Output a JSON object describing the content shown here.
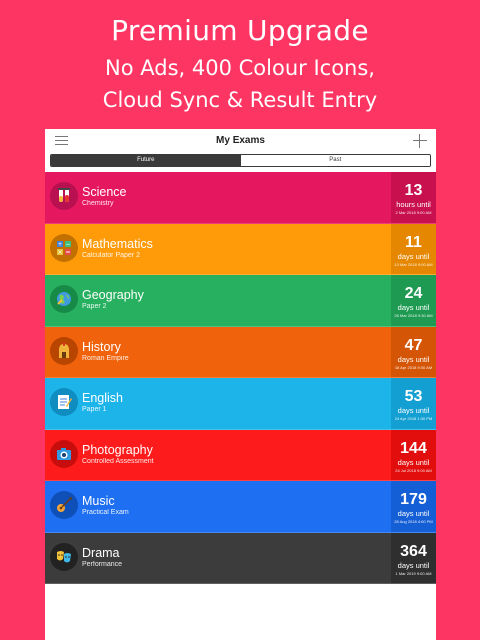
{
  "promo": {
    "title": "Premium Upgrade",
    "line1": "No Ads, 400 Colour Icons,",
    "line2": "Cloud Sync & Result Entry"
  },
  "navbar": {
    "title": "My Exams",
    "menu_icon": "hamburger-menu-icon",
    "add_icon": "plus-icon"
  },
  "tabs": [
    {
      "label": "Future",
      "active": true
    },
    {
      "label": "Past",
      "active": false
    }
  ],
  "exams": [
    {
      "subject": "Science",
      "detail": "Chemistry",
      "count": "13",
      "unit": "hours until",
      "date": "2 Mar 2018 9:00 AM",
      "color": "#e5175f",
      "accent": "#c8104f",
      "icon": "test-tubes-icon"
    },
    {
      "subject": "Mathematics",
      "detail": "Calculator Paper 2",
      "count": "11",
      "unit": "days until",
      "date": "13 Mar 2018 9:00 AM",
      "color": "#ff9a09",
      "accent": "#e58700",
      "icon": "calculator-icon"
    },
    {
      "subject": "Geography",
      "detail": "Paper 2",
      "count": "24",
      "unit": "days until",
      "date": "26 Mar 2018 9:30 AM",
      "color": "#27b05f",
      "accent": "#1f9a52",
      "icon": "globe-icon"
    },
    {
      "subject": "History",
      "detail": "Roman Empire",
      "count": "47",
      "unit": "days until",
      "date": "18 Apr 2018 9:00 AM",
      "color": "#f0620c",
      "accent": "#d45506",
      "icon": "helmet-icon"
    },
    {
      "subject": "English",
      "detail": "Paper 1",
      "count": "53",
      "unit": "days until",
      "date": "24 Apr 2018 1:30 PM",
      "color": "#1db4ea",
      "accent": "#139fd2",
      "icon": "notepad-icon"
    },
    {
      "subject": "Photography",
      "detail": "Controlled Assessment",
      "count": "144",
      "unit": "days until",
      "date": "24 Jul 2018 9:00 AM",
      "color": "#fe1b1b",
      "accent": "#e20d0d",
      "icon": "camera-icon"
    },
    {
      "subject": "Music",
      "detail": "Practical Exam",
      "count": "179",
      "unit": "days until",
      "date": "28 Aug 2018 4:00 PM",
      "color": "#1e6ff1",
      "accent": "#145fd6",
      "icon": "guitar-icon"
    },
    {
      "subject": "Drama",
      "detail": "Performance",
      "count": "364",
      "unit": "days until",
      "date": "1 Mar 2019 9:00 AM",
      "color": "#3c3c3c",
      "accent": "#2f2f2f",
      "icon": "theatre-masks-icon"
    }
  ]
}
